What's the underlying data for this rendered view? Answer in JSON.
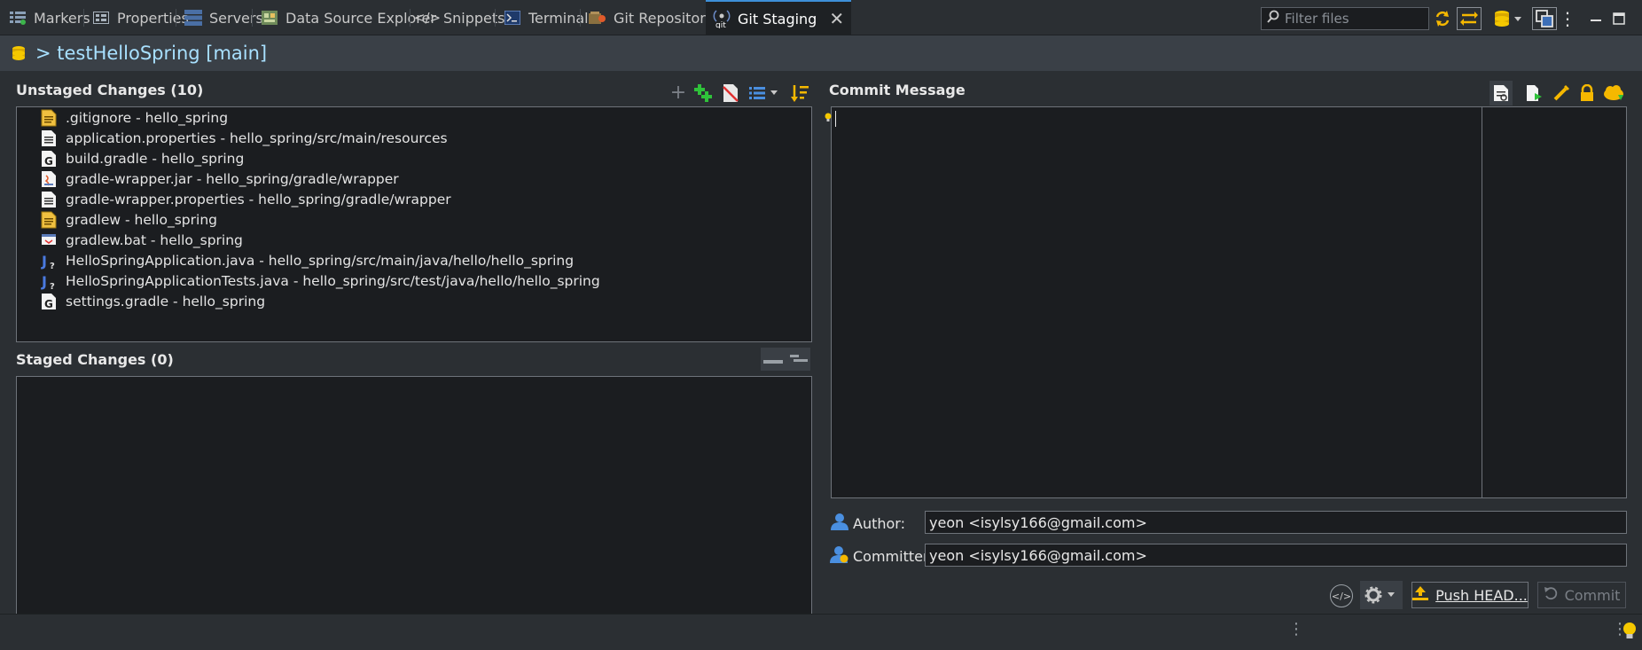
{
  "tabs": [
    {
      "label": "Markers",
      "icon": "markers-icon"
    },
    {
      "label": "Properties",
      "icon": "properties-icon"
    },
    {
      "label": "Servers",
      "icon": "servers-icon"
    },
    {
      "label": "Data Source Explorer",
      "icon": "data-source-icon"
    },
    {
      "label": "Snippets",
      "icon": "snippets-icon"
    },
    {
      "label": "Terminal",
      "icon": "terminal-icon"
    },
    {
      "label": "Git Repositories",
      "icon": "git-repositories-icon"
    },
    {
      "label": "Git Staging",
      "icon": "git-staging-icon",
      "active": true
    }
  ],
  "filter": {
    "placeholder": "Filter files"
  },
  "header": {
    "title": "> testHelloSpring [main]"
  },
  "unstaged": {
    "title": "Unstaged Changes (10)",
    "files": [
      {
        "label": ".gitignore - hello_spring",
        "icon": "text-file-icon"
      },
      {
        "label": "application.properties - hello_spring/src/main/resources",
        "icon": "properties-file-icon"
      },
      {
        "label": "build.gradle - hello_spring",
        "icon": "gradle-file-icon"
      },
      {
        "label": "gradle-wrapper.jar - hello_spring/gradle/wrapper",
        "icon": "jar-file-icon"
      },
      {
        "label": "gradle-wrapper.properties - hello_spring/gradle/wrapper",
        "icon": "properties-file-icon"
      },
      {
        "label": "gradlew - hello_spring",
        "icon": "text-file-icon"
      },
      {
        "label": "gradlew.bat - hello_spring",
        "icon": "bat-file-icon"
      },
      {
        "label": "HelloSpringApplication.java - hello_spring/src/main/java/hello/hello_spring",
        "icon": "java-file-icon"
      },
      {
        "label": "HelloSpringApplicationTests.java - hello_spring/src/test/java/hello/hello_spring",
        "icon": "java-file-icon"
      },
      {
        "label": "settings.gradle - hello_spring",
        "icon": "gradle-file-icon"
      }
    ]
  },
  "staged": {
    "title": "Staged Changes (0)"
  },
  "commit": {
    "title": "Commit Message",
    "author_label": "Author:",
    "author_value": "yeon <isylsy166@gmail.com>",
    "committer_label": "Committer:",
    "committer_value": "yeon <isylsy166@gmail.com>",
    "push_label": "Push HEAD...",
    "commit_label": "Commit"
  },
  "colors": {
    "accent": "#3d8fd8",
    "highlight": "#ff0000",
    "add": "#2fc23a",
    "warn": "#f5b800"
  }
}
